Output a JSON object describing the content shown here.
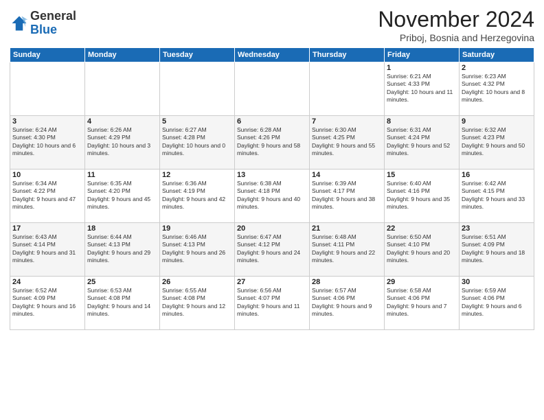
{
  "logo": {
    "general": "General",
    "blue": "Blue"
  },
  "title": "November 2024",
  "location": "Priboj, Bosnia and Herzegovina",
  "headers": [
    "Sunday",
    "Monday",
    "Tuesday",
    "Wednesday",
    "Thursday",
    "Friday",
    "Saturday"
  ],
  "weeks": [
    [
      {
        "day": "",
        "sunrise": "",
        "sunset": "",
        "daylight": ""
      },
      {
        "day": "",
        "sunrise": "",
        "sunset": "",
        "daylight": ""
      },
      {
        "day": "",
        "sunrise": "",
        "sunset": "",
        "daylight": ""
      },
      {
        "day": "",
        "sunrise": "",
        "sunset": "",
        "daylight": ""
      },
      {
        "day": "",
        "sunrise": "",
        "sunset": "",
        "daylight": ""
      },
      {
        "day": "1",
        "sunrise": "Sunrise: 6:21 AM",
        "sunset": "Sunset: 4:33 PM",
        "daylight": "Daylight: 10 hours and 11 minutes."
      },
      {
        "day": "2",
        "sunrise": "Sunrise: 6:23 AM",
        "sunset": "Sunset: 4:32 PM",
        "daylight": "Daylight: 10 hours and 8 minutes."
      }
    ],
    [
      {
        "day": "3",
        "sunrise": "Sunrise: 6:24 AM",
        "sunset": "Sunset: 4:30 PM",
        "daylight": "Daylight: 10 hours and 6 minutes."
      },
      {
        "day": "4",
        "sunrise": "Sunrise: 6:26 AM",
        "sunset": "Sunset: 4:29 PM",
        "daylight": "Daylight: 10 hours and 3 minutes."
      },
      {
        "day": "5",
        "sunrise": "Sunrise: 6:27 AM",
        "sunset": "Sunset: 4:28 PM",
        "daylight": "Daylight: 10 hours and 0 minutes."
      },
      {
        "day": "6",
        "sunrise": "Sunrise: 6:28 AM",
        "sunset": "Sunset: 4:26 PM",
        "daylight": "Daylight: 9 hours and 58 minutes."
      },
      {
        "day": "7",
        "sunrise": "Sunrise: 6:30 AM",
        "sunset": "Sunset: 4:25 PM",
        "daylight": "Daylight: 9 hours and 55 minutes."
      },
      {
        "day": "8",
        "sunrise": "Sunrise: 6:31 AM",
        "sunset": "Sunset: 4:24 PM",
        "daylight": "Daylight: 9 hours and 52 minutes."
      },
      {
        "day": "9",
        "sunrise": "Sunrise: 6:32 AM",
        "sunset": "Sunset: 4:23 PM",
        "daylight": "Daylight: 9 hours and 50 minutes."
      }
    ],
    [
      {
        "day": "10",
        "sunrise": "Sunrise: 6:34 AM",
        "sunset": "Sunset: 4:22 PM",
        "daylight": "Daylight: 9 hours and 47 minutes."
      },
      {
        "day": "11",
        "sunrise": "Sunrise: 6:35 AM",
        "sunset": "Sunset: 4:20 PM",
        "daylight": "Daylight: 9 hours and 45 minutes."
      },
      {
        "day": "12",
        "sunrise": "Sunrise: 6:36 AM",
        "sunset": "Sunset: 4:19 PM",
        "daylight": "Daylight: 9 hours and 42 minutes."
      },
      {
        "day": "13",
        "sunrise": "Sunrise: 6:38 AM",
        "sunset": "Sunset: 4:18 PM",
        "daylight": "Daylight: 9 hours and 40 minutes."
      },
      {
        "day": "14",
        "sunrise": "Sunrise: 6:39 AM",
        "sunset": "Sunset: 4:17 PM",
        "daylight": "Daylight: 9 hours and 38 minutes."
      },
      {
        "day": "15",
        "sunrise": "Sunrise: 6:40 AM",
        "sunset": "Sunset: 4:16 PM",
        "daylight": "Daylight: 9 hours and 35 minutes."
      },
      {
        "day": "16",
        "sunrise": "Sunrise: 6:42 AM",
        "sunset": "Sunset: 4:15 PM",
        "daylight": "Daylight: 9 hours and 33 minutes."
      }
    ],
    [
      {
        "day": "17",
        "sunrise": "Sunrise: 6:43 AM",
        "sunset": "Sunset: 4:14 PM",
        "daylight": "Daylight: 9 hours and 31 minutes."
      },
      {
        "day": "18",
        "sunrise": "Sunrise: 6:44 AM",
        "sunset": "Sunset: 4:13 PM",
        "daylight": "Daylight: 9 hours and 29 minutes."
      },
      {
        "day": "19",
        "sunrise": "Sunrise: 6:46 AM",
        "sunset": "Sunset: 4:13 PM",
        "daylight": "Daylight: 9 hours and 26 minutes."
      },
      {
        "day": "20",
        "sunrise": "Sunrise: 6:47 AM",
        "sunset": "Sunset: 4:12 PM",
        "daylight": "Daylight: 9 hours and 24 minutes."
      },
      {
        "day": "21",
        "sunrise": "Sunrise: 6:48 AM",
        "sunset": "Sunset: 4:11 PM",
        "daylight": "Daylight: 9 hours and 22 minutes."
      },
      {
        "day": "22",
        "sunrise": "Sunrise: 6:50 AM",
        "sunset": "Sunset: 4:10 PM",
        "daylight": "Daylight: 9 hours and 20 minutes."
      },
      {
        "day": "23",
        "sunrise": "Sunrise: 6:51 AM",
        "sunset": "Sunset: 4:09 PM",
        "daylight": "Daylight: 9 hours and 18 minutes."
      }
    ],
    [
      {
        "day": "24",
        "sunrise": "Sunrise: 6:52 AM",
        "sunset": "Sunset: 4:09 PM",
        "daylight": "Daylight: 9 hours and 16 minutes."
      },
      {
        "day": "25",
        "sunrise": "Sunrise: 6:53 AM",
        "sunset": "Sunset: 4:08 PM",
        "daylight": "Daylight: 9 hours and 14 minutes."
      },
      {
        "day": "26",
        "sunrise": "Sunrise: 6:55 AM",
        "sunset": "Sunset: 4:08 PM",
        "daylight": "Daylight: 9 hours and 12 minutes."
      },
      {
        "day": "27",
        "sunrise": "Sunrise: 6:56 AM",
        "sunset": "Sunset: 4:07 PM",
        "daylight": "Daylight: 9 hours and 11 minutes."
      },
      {
        "day": "28",
        "sunrise": "Sunrise: 6:57 AM",
        "sunset": "Sunset: 4:06 PM",
        "daylight": "Daylight: 9 hours and 9 minutes."
      },
      {
        "day": "29",
        "sunrise": "Sunrise: 6:58 AM",
        "sunset": "Sunset: 4:06 PM",
        "daylight": "Daylight: 9 hours and 7 minutes."
      },
      {
        "day": "30",
        "sunrise": "Sunrise: 6:59 AM",
        "sunset": "Sunset: 4:06 PM",
        "daylight": "Daylight: 9 hours and 6 minutes."
      }
    ]
  ]
}
